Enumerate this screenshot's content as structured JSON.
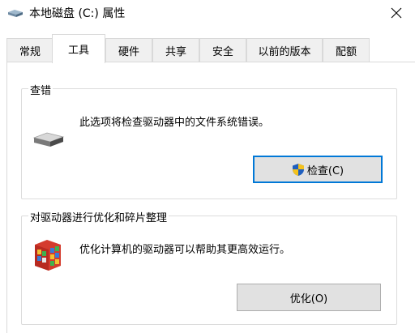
{
  "window": {
    "title": "本地磁盘 (C:) 属性",
    "icon": "drive-icon",
    "close_icon": "close-icon"
  },
  "tabs": [
    {
      "label": "常规",
      "active": false
    },
    {
      "label": "工具",
      "active": true
    },
    {
      "label": "硬件",
      "active": false
    },
    {
      "label": "共享",
      "active": false
    },
    {
      "label": "安全",
      "active": false
    },
    {
      "label": "以前的版本",
      "active": false
    },
    {
      "label": "配额",
      "active": false
    }
  ],
  "error_checking": {
    "group_title": "查错",
    "description": "此选项将检查驱动器中的文件系统错误。",
    "icon": "hard-drive-icon",
    "button_label": "检查(C)",
    "button_icon": "uac-shield-icon"
  },
  "optimize": {
    "group_title": "对驱动器进行优化和碎片整理",
    "description": "优化计算机的驱动器可以帮助其更高效运行。",
    "icon": "defrag-icon",
    "button_label": "优化(O)"
  },
  "colors": {
    "focus_border": "#0078d7",
    "button_bg": "#e1e1e1",
    "tab_bg": "#f0f0f0"
  }
}
